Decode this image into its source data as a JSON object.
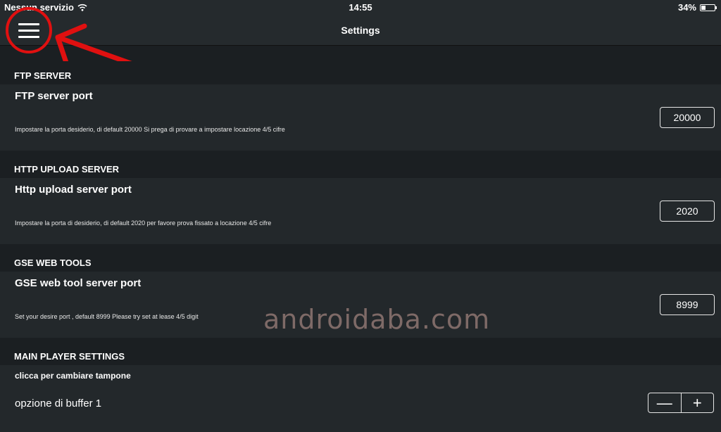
{
  "status_bar": {
    "carrier": "Nessun servizio",
    "time": "14:55",
    "battery": "34%",
    "battery_level": 0.34
  },
  "nav": {
    "title": "Settings",
    "menu_icon": "hamburger-menu-icon"
  },
  "sections": {
    "ftp": {
      "header": "FTP SERVER",
      "label": "FTP server port",
      "description": "Impostare la porta desiderio, di default 20000 Si prega di provare a impostare locazione 4/5 cifre",
      "value": "20000"
    },
    "http": {
      "header": "HTTP UPLOAD SERVER",
      "label": "Http upload server port",
      "description": "Impostare la porta di desiderio, di default 2020 per favore prova fissato a locazione 4/5 cifre",
      "value": "2020"
    },
    "gse": {
      "header": "GSE WEB TOOLS",
      "label": "GSE web tool server port",
      "description": "Set your desire port , default 8999 Please try set at lease 4/5 digit",
      "value": "8999"
    },
    "player": {
      "header": "MAIN PLAYER SETTINGS",
      "label": "clicca per cambiare tampone",
      "option": "opzione di buffer 1",
      "minus": "—",
      "plus": "+"
    }
  },
  "watermark": "androidaba.com",
  "colors": {
    "annotation_red": "#e01010",
    "background": "#1b1f22",
    "card": "#23282b"
  }
}
